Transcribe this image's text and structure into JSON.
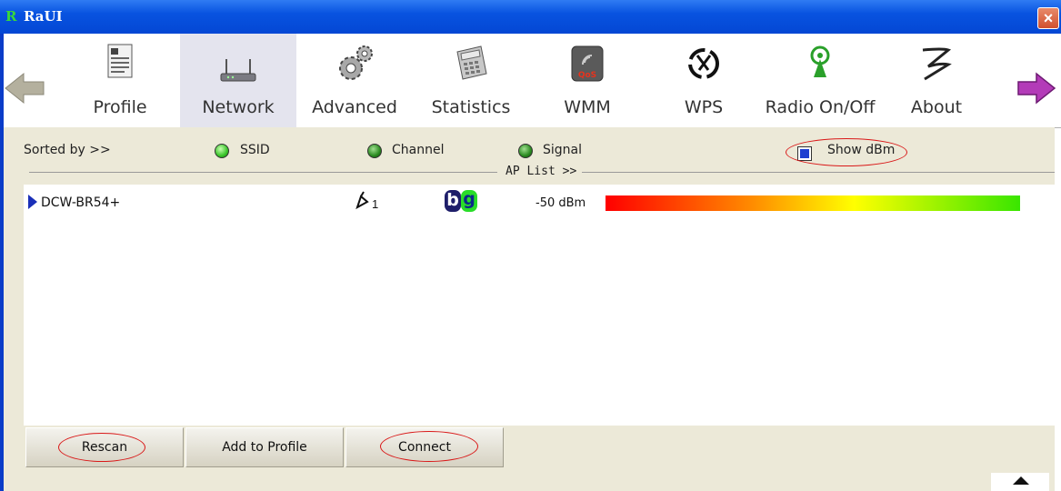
{
  "window": {
    "logo": "R",
    "title": "RaUI",
    "close_glyph": "×"
  },
  "toolbar": {
    "items": [
      {
        "label": "Profile",
        "icon": "profile-document-icon"
      },
      {
        "label": "Network",
        "icon": "router-icon",
        "active": true
      },
      {
        "label": "Advanced",
        "icon": "gears-icon"
      },
      {
        "label": "Statistics",
        "icon": "calculator-icon"
      },
      {
        "label": "WMM",
        "icon": "qos-icon",
        "icon_text": "QoS"
      },
      {
        "label": "WPS",
        "icon": "wps-icon"
      },
      {
        "label": "Radio On/Off",
        "icon": "radio-antenna-icon"
      },
      {
        "label": "About",
        "icon": "about-logo-icon"
      }
    ]
  },
  "sort": {
    "label": "Sorted by >>",
    "options": [
      {
        "label": "SSID",
        "selected": true
      },
      {
        "label": "Channel",
        "selected": false
      },
      {
        "label": "Signal",
        "selected": false
      }
    ],
    "show_dbm_label": "Show dBm",
    "show_dbm_checked": true
  },
  "ap_list": {
    "label": "AP List >>",
    "rows": [
      {
        "ssid": "DCW-BR54+",
        "channel": "1",
        "modes": [
          "b",
          "g"
        ],
        "signal": "-50 dBm",
        "signal_fraction": 1.0
      }
    ]
  },
  "buttons": {
    "rescan": "Rescan",
    "add_to_profile": "Add to Profile",
    "connect": "Connect"
  },
  "colors": {
    "titlebar": "#0853e0",
    "active_tab": "#e4e4ee",
    "highlight_oval": "#d91818"
  }
}
